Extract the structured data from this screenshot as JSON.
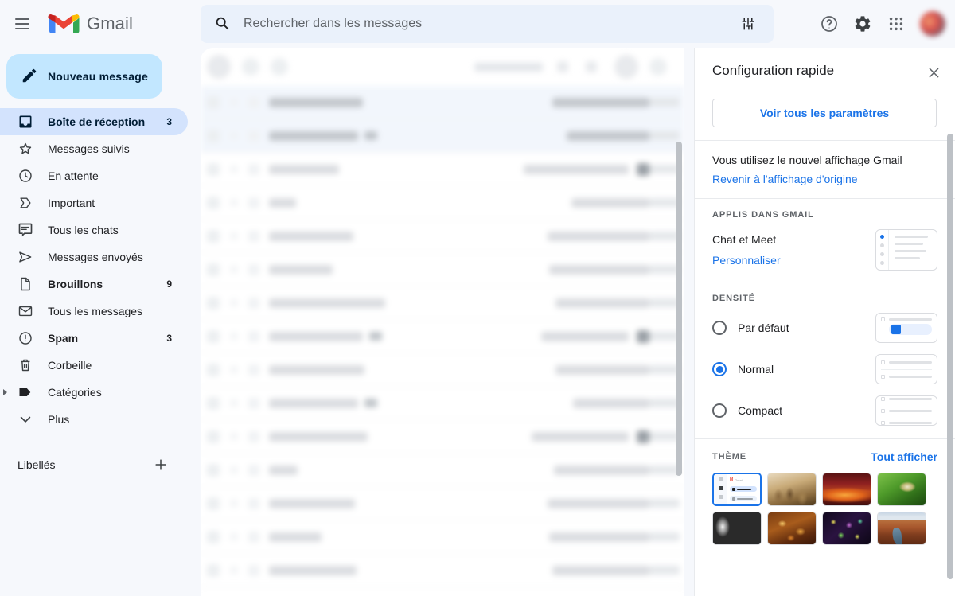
{
  "topbar": {
    "menu_icon": "hamburger-menu-icon",
    "brand": "Gmail",
    "brand_logo_icon": "gmail-logo-icon",
    "search": {
      "placeholder": "Rechercher dans les messages",
      "value": "",
      "search_icon": "search-icon",
      "options_icon": "search-options-icon"
    },
    "help_icon": "help-icon",
    "settings_icon": "gear-icon",
    "apps_icon": "apps-grid-icon",
    "avatar_label": "Compte Google"
  },
  "sidebar": {
    "compose": {
      "label": "Nouveau message",
      "icon": "pencil-icon"
    },
    "items": [
      {
        "label": "Boîte de réception",
        "count": "3",
        "icon": "inbox-icon",
        "active": true,
        "bold": true
      },
      {
        "label": "Messages suivis",
        "count": "",
        "icon": "star-icon",
        "active": false,
        "bold": false
      },
      {
        "label": "En attente",
        "count": "",
        "icon": "clock-icon",
        "active": false,
        "bold": false
      },
      {
        "label": "Important",
        "count": "",
        "icon": "important-chevron-icon",
        "active": false,
        "bold": false
      },
      {
        "label": "Tous les chats",
        "count": "",
        "icon": "chat-bubble-icon",
        "active": false,
        "bold": false
      },
      {
        "label": "Messages envoyés",
        "count": "",
        "icon": "send-icon",
        "active": false,
        "bold": false
      },
      {
        "label": "Brouillons",
        "count": "9",
        "icon": "draft-page-icon",
        "active": false,
        "bold": true
      },
      {
        "label": "Tous les messages",
        "count": "",
        "icon": "envelope-icon",
        "active": false,
        "bold": false
      },
      {
        "label": "Spam",
        "count": "3",
        "icon": "spam-exclamation-icon",
        "active": false,
        "bold": true
      },
      {
        "label": "Corbeille",
        "count": "",
        "icon": "trash-icon",
        "active": false,
        "bold": false
      },
      {
        "label": "Catégories",
        "count": "",
        "icon": "label-tag-icon",
        "active": false,
        "bold": false,
        "expandable": true
      },
      {
        "label": "Plus",
        "count": "",
        "icon": "chevron-down-icon",
        "active": false,
        "bold": false
      }
    ],
    "labels_header": {
      "title": "Libellés",
      "add_icon": "plus-icon"
    }
  },
  "maillist": {
    "rows_blurred": true,
    "rows": [
      {
        "unread": true,
        "sender_w": 118,
        "subject_w": 122,
        "chip": false,
        "attach": false
      },
      {
        "unread": true,
        "sender_w": 112,
        "subject_w": 104,
        "chip": true,
        "attach": false
      },
      {
        "unread": false,
        "sender_w": 88,
        "subject_w": 132,
        "chip": false,
        "attach": true
      },
      {
        "unread": false,
        "sender_w": 34,
        "subject_w": 98,
        "chip": false,
        "attach": false
      },
      {
        "unread": false,
        "sender_w": 106,
        "subject_w": 128,
        "chip": false,
        "attach": false
      },
      {
        "unread": false,
        "sender_w": 80,
        "subject_w": 126,
        "chip": false,
        "attach": false
      },
      {
        "unread": false,
        "sender_w": 146,
        "subject_w": 118,
        "chip": false,
        "attach": false
      },
      {
        "unread": false,
        "sender_w": 118,
        "subject_w": 110,
        "chip": true,
        "attach": true
      },
      {
        "unread": false,
        "sender_w": 120,
        "subject_w": 118,
        "chip": false,
        "attach": false
      },
      {
        "unread": false,
        "sender_w": 112,
        "subject_w": 96,
        "chip": true,
        "attach": false
      },
      {
        "unread": false,
        "sender_w": 124,
        "subject_w": 122,
        "chip": false,
        "attach": true
      },
      {
        "unread": false,
        "sender_w": 36,
        "subject_w": 120,
        "chip": false,
        "attach": false
      },
      {
        "unread": false,
        "sender_w": 108,
        "subject_w": 128,
        "chip": false,
        "attach": false
      },
      {
        "unread": false,
        "sender_w": 66,
        "subject_w": 126,
        "chip": false,
        "attach": false
      },
      {
        "unread": false,
        "sender_w": 110,
        "subject_w": 122,
        "chip": false,
        "attach": false
      }
    ]
  },
  "panel": {
    "title": "Configuration rapide",
    "close_icon": "close-icon",
    "see_all_settings": "Voir tous les paramètres",
    "notice": {
      "text": "Vous utilisez le nouvel affichage Gmail",
      "link": "Revenir à l'affichage d'origine"
    },
    "apps": {
      "section_label": "APPLIS DANS GMAIL",
      "name": "Chat et Meet",
      "link": "Personnaliser",
      "preview_icon": "chat-meet-preview-icon"
    },
    "density": {
      "section_label": "DENSITÉ",
      "options": [
        {
          "label": "Par défaut",
          "selected": false,
          "preview_icon": "density-default-preview-icon"
        },
        {
          "label": "Normal",
          "selected": true,
          "preview_icon": "density-normal-preview-icon"
        },
        {
          "label": "Compact",
          "selected": false,
          "preview_icon": "density-compact-preview-icon"
        }
      ]
    },
    "theme": {
      "section_label": "THÈME",
      "see_all": "Tout afficher",
      "thumbs": [
        {
          "name": "theme-default-gmail",
          "selected": true,
          "style": "tt-default"
        },
        {
          "name": "theme-chess-pieces",
          "selected": false,
          "style": "tt-chess"
        },
        {
          "name": "theme-red-canyon",
          "selected": false,
          "style": "tt-canyon"
        },
        {
          "name": "theme-green-leaf",
          "selected": false,
          "style": "tt-leaf"
        },
        {
          "name": "theme-metal-spheres",
          "selected": false,
          "style": "tt-metal"
        },
        {
          "name": "theme-autumn-leaves",
          "selected": false,
          "style": "tt-autumn"
        },
        {
          "name": "theme-colored-beads",
          "selected": false,
          "style": "tt-beads"
        },
        {
          "name": "theme-canyon-river",
          "selected": false,
          "style": "tt-river"
        }
      ]
    }
  },
  "colors": {
    "accent_blue": "#1a73e8",
    "compose_blue": "#c2e7ff",
    "active_nav_blue": "#d3e3fd",
    "app_bg": "#f6f8fc",
    "search_bg": "#eaf1fb"
  }
}
